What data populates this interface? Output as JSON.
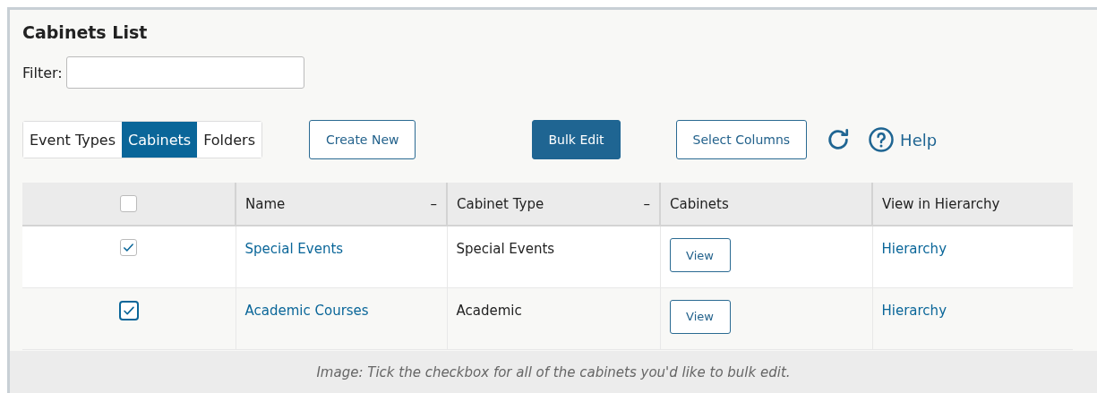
{
  "title": "Cabinets List",
  "filter": {
    "label": "Filter:"
  },
  "tabs": [
    {
      "label": "Event Types",
      "selected": false
    },
    {
      "label": "Cabinets",
      "selected": true
    },
    {
      "label": "Folders",
      "selected": false
    }
  ],
  "buttons": [
    {
      "label": "Create New",
      "kind": "outline"
    },
    {
      "label": "Bulk Edit",
      "kind": "primary"
    },
    {
      "label": "Select Columns",
      "kind": "outline"
    }
  ],
  "help": {
    "label": "Help"
  },
  "table": {
    "select_all": {
      "checked": false
    },
    "columns": [
      {
        "label": "Name",
        "sort_mark": "–"
      },
      {
        "label": "Cabinet Type",
        "sort_mark": "–"
      },
      {
        "label": "Cabinets"
      },
      {
        "label": "View in Hierarchy"
      }
    ],
    "rows": [
      {
        "checked": true,
        "focused": false,
        "name": "Special Events",
        "type": "Special Events",
        "action": "View",
        "link": "Hierarchy"
      },
      {
        "checked": true,
        "focused": true,
        "name": "Academic Courses",
        "type": "Academic",
        "action": "View",
        "link": "Hierarchy"
      }
    ]
  },
  "caption": "Image: Tick the checkbox for all of the cabinets you'd like to bulk edit."
}
